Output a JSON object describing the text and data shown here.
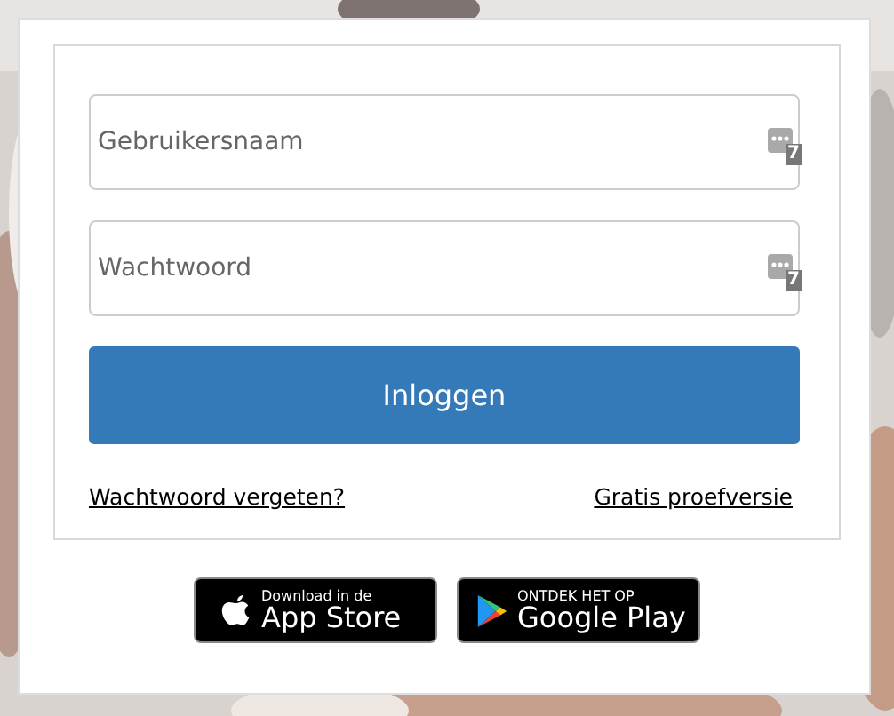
{
  "fields": [
    {
      "placeholder": "Gebruikersnaam",
      "badge": "7"
    },
    {
      "placeholder": "Wachtwoord",
      "badge": "7"
    }
  ],
  "login_button": "Inloggen",
  "links": [
    "Wachtwoord vergeten?",
    "Gratis proefversie"
  ],
  "store_badges": [
    {
      "kind": "apple",
      "small": "Download in de",
      "large": "App Store"
    },
    {
      "kind": "google",
      "small": "ONTDEK HET OP",
      "large": "Google Play"
    }
  ]
}
